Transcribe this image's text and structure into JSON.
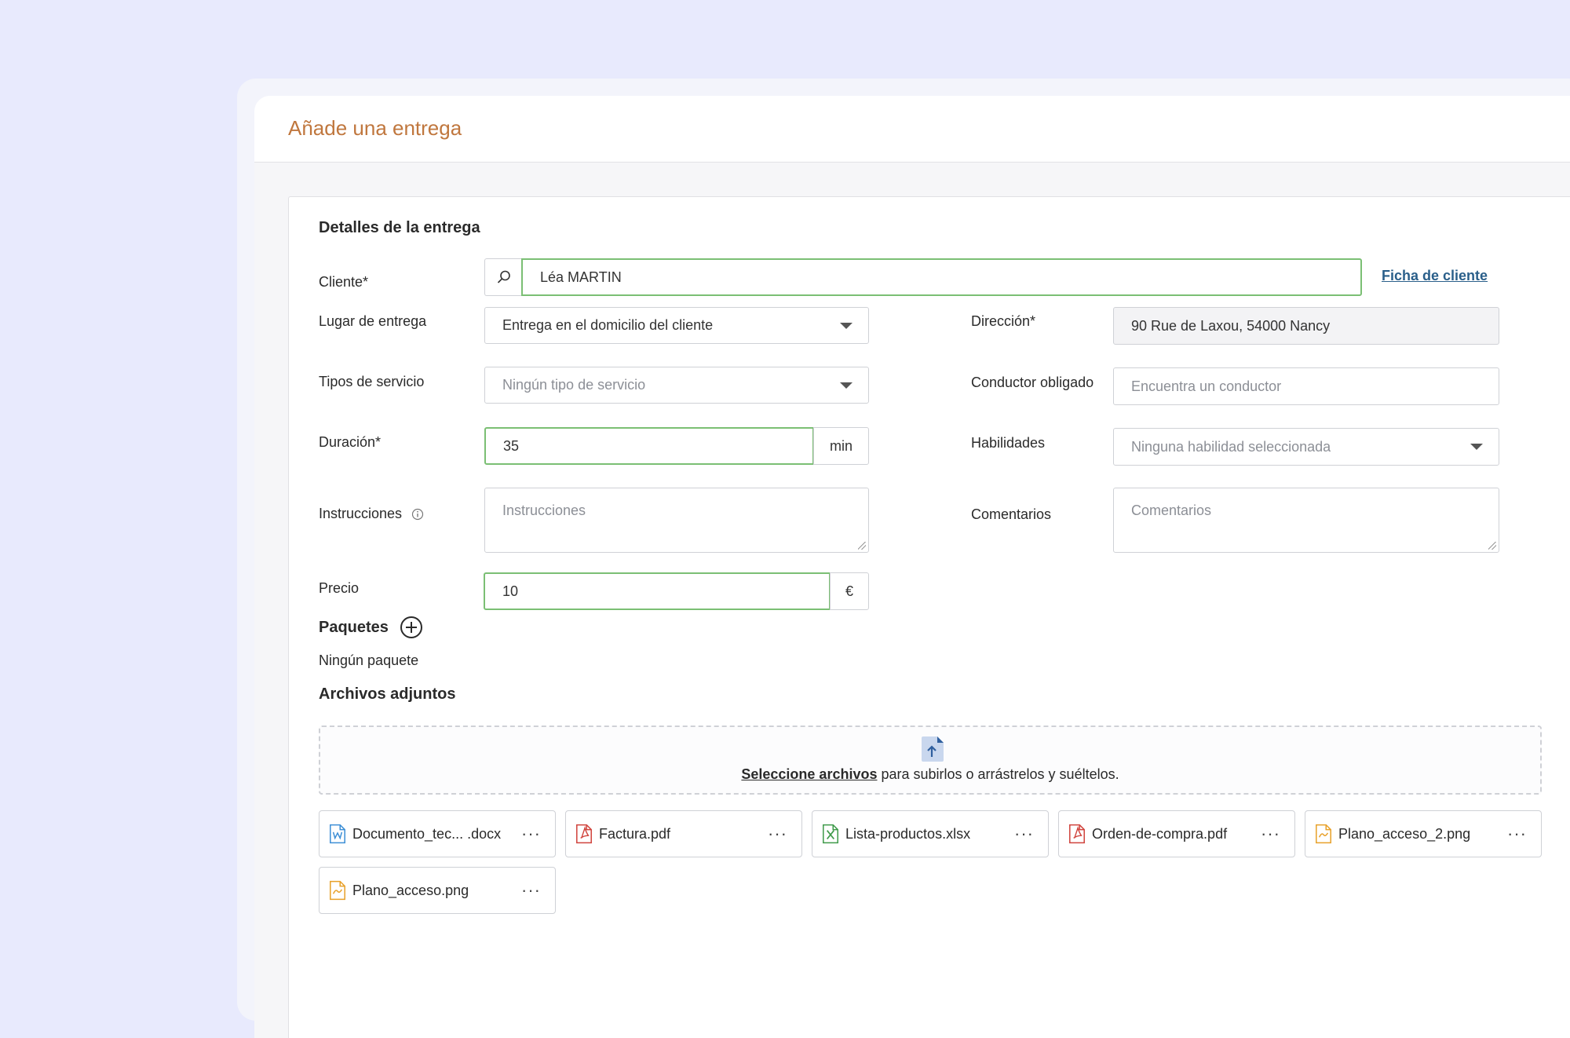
{
  "header": {
    "title": "Añade una entrega"
  },
  "section_details": "Detalles de la entrega",
  "client": {
    "label": "Cliente*",
    "value": "Léa MARTIN",
    "link": "Ficha de cliente"
  },
  "delivery_place": {
    "label": "Lugar de entrega",
    "value": "Entrega en el domicilio del cliente"
  },
  "address": {
    "label": "Dirección*",
    "value": "90 Rue de Laxou, 54000 Nancy"
  },
  "service_types": {
    "label": "Tipos de servicio",
    "placeholder": "Ningún tipo de servicio"
  },
  "driver": {
    "label": "Conductor obligado",
    "placeholder": "Encuentra un conductor"
  },
  "duration": {
    "label": "Duración*",
    "value": "35",
    "unit": "min"
  },
  "skills": {
    "label": "Habilidades",
    "placeholder": "Ninguna habilidad seleccionada"
  },
  "instructions": {
    "label": "Instrucciones",
    "placeholder": "Instrucciones"
  },
  "comments": {
    "label": "Comentarios",
    "placeholder": "Comentarios"
  },
  "price": {
    "label": "Precio",
    "value": "10",
    "unit": "€"
  },
  "packages": {
    "title": "Paquetes",
    "empty": "Ningún paquete"
  },
  "attachments": {
    "title": "Archivos adjuntos",
    "dropzone_link": "Seleccione archivos",
    "dropzone_text": " para subirlos o arrástrelos y suéltelos.",
    "files": [
      {
        "name": "Documento_tec... .docx",
        "icon": "word-file-icon",
        "color": "#3d8fd6"
      },
      {
        "name": "Factura.pdf",
        "icon": "pdf-file-icon",
        "color": "#d0433c"
      },
      {
        "name": "Lista-productos.xlsx",
        "icon": "excel-file-icon",
        "color": "#3f9a4a"
      },
      {
        "name": "Orden-de-compra.pdf",
        "icon": "pdf-file-icon",
        "color": "#d0433c"
      },
      {
        "name": "Plano_acceso_2.png",
        "icon": "image-file-icon",
        "color": "#e8a12a"
      },
      {
        "name": "Plano_acceso.png",
        "icon": "image-file-icon",
        "color": "#e8a12a"
      }
    ],
    "more": "···"
  }
}
